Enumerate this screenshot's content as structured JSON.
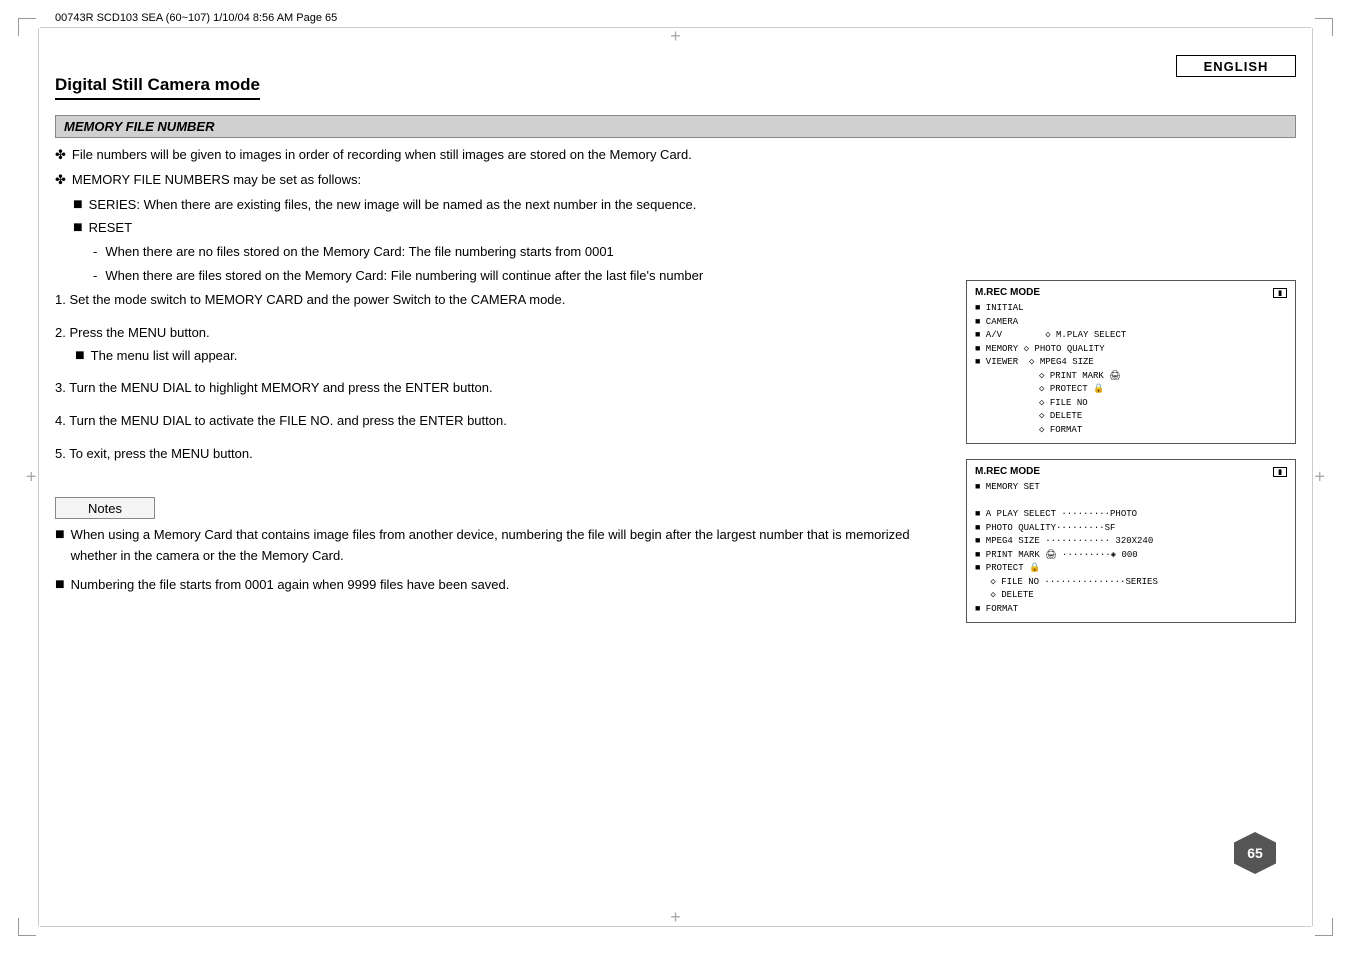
{
  "page": {
    "info": "00743R SCD103 SEA (60~107)   1/10/04  8:56 AM   Page 65",
    "english_label": "ENGLISH",
    "page_number": "65"
  },
  "title": "Digital Still Camera mode",
  "section_header": "MEMORY FILE NUMBER",
  "intro": {
    "cross1": "File numbers will be given to images in order of recording when still images are stored on the Memory Card.",
    "cross2": "MEMORY FILE NUMBERS may be set as follows:",
    "bullet_series_label": "SERIES: When there are existing files, the new image will be named as the next number in the sequence.",
    "bullet_reset_label": "RESET",
    "dash1": "When there are no files stored on the Memory Card: The file numbering starts from 0001",
    "dash2": "When there are files stored on the Memory Card: File numbering will continue after the last file's number"
  },
  "steps": [
    {
      "number": "1.",
      "text": "Set the mode switch to MEMORY CARD and the power Switch to the CAMERA mode."
    },
    {
      "number": "2.",
      "text": "Press the MENU button.",
      "sub": "The menu list will appear."
    },
    {
      "number": "3.",
      "text": "Turn the MENU DIAL to highlight MEMORY and press the ENTER button."
    },
    {
      "number": "4.",
      "text": "Turn the MENU DIAL to activate the FILE NO. and press the ENTER button."
    },
    {
      "number": "5.",
      "text": "To exit, press the MENU button."
    }
  ],
  "notes_label": "Notes",
  "notes": [
    "When using a Memory Card that contains image files from another device, numbering the file will begin after the largest number that is memorized whether in the camera or the the Memory Card.",
    "Numbering the file starts from 0001 again when 9999 files have been saved."
  ],
  "screen1": {
    "header_left": "M.REC  MODE",
    "rows": [
      "■ INITIAL",
      "■ CAMERA",
      "■ A/V          ◇ M.PLAY SELECT",
      "■ MEMORY  ◇ PHOTO QUALITY",
      "■ VIEWER   ◇ MPEG4 SIZE",
      "           ◇ PRINT MARK 🖨",
      "           ◇ PROTECT  🔒",
      "           ◇ FILE NO",
      "           ◇ DELETE",
      "           ◇ FORMAT"
    ]
  },
  "screen2": {
    "header_left": "M.REC  MODE",
    "rows": [
      "■ MEMORY SET",
      "",
      "■ A PLAY SELECT ·········PHOTO",
      "■ PHOTO QUALITY··········SF",
      "■ MPEG4 SIZE ············ 320X240",
      "■ PRINT MARK 🖨  ·········◈ 000",
      "■ PROTECT 🔒",
      "  ◇ FILE NO ···············SERIES",
      "  ◇ DELETE",
      "■ FORMAT"
    ]
  }
}
